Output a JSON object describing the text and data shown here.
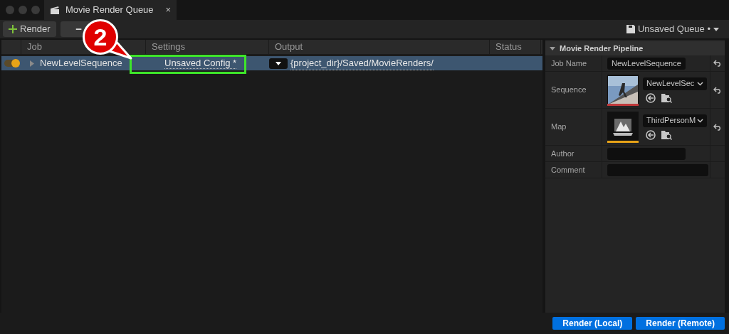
{
  "window": {
    "tab_title": "Movie Render Queue",
    "tab_close": "×"
  },
  "toolbar": {
    "add_button": "Render",
    "remove_button": "−",
    "queue_menu": "Unsaved Queue •"
  },
  "table": {
    "columns": [
      "Job",
      "Settings",
      "Output",
      "Status"
    ],
    "rows": [
      {
        "enabled": true,
        "selected": true,
        "job": "NewLevelSequence",
        "settings": "Unsaved Config *",
        "output": "{project_dir}/Saved/MovieRenders/"
      }
    ]
  },
  "details": {
    "title": "Movie Render Pipeline",
    "expanded": true,
    "fields": [
      {
        "kind": "text",
        "label": "Job Name",
        "value": "NewLevelSequence",
        "reset": true
      },
      {
        "kind": "sequence",
        "label": "Sequence",
        "value": "NewLevelSec",
        "color": "#c0393b",
        "reset": true
      },
      {
        "kind": "map",
        "label": "Map",
        "value": "ThirdPersonM",
        "color": "#e8a317",
        "reset": true
      },
      {
        "kind": "text",
        "label": "Author",
        "reset": false
      },
      {
        "kind": "wide",
        "label": "Comment",
        "reset": false
      }
    ]
  },
  "footer": {
    "buttons": [
      "Render (Local)",
      "Render (Remote)"
    ]
  },
  "callout": {
    "number": "2"
  }
}
